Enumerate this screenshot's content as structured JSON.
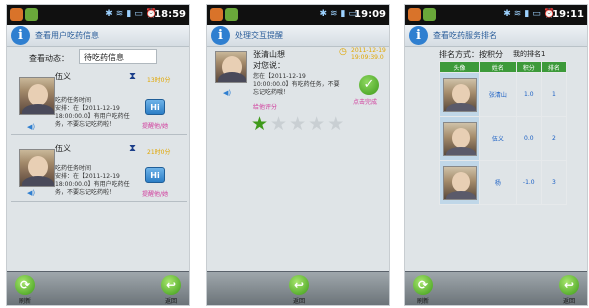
{
  "screens": [
    {
      "time": "18:59",
      "header_title": "查看用户吃药信息",
      "filter_label": "查看动态：",
      "filter_value": "待吃药信息",
      "items": [
        {
          "name": "伍义",
          "remaining": "13时0分",
          "message": "吃药任务时间\n安排：在【2011-12-19\n18:00:00.0】有用户吃药任\n务，不要忘记吃药啦！",
          "hi": "Hi",
          "remind": "提醒他/她"
        },
        {
          "name": "伍义",
          "remaining": "21时0分",
          "message": "吃药任务时间\n安排：在【2011-12-19\n18:00:00.0】有用户吃药任\n务，不要忘记吃药啦！",
          "hi": "Hi",
          "remind": "提醒他/她"
        }
      ],
      "toolbar": {
        "left": "刷新",
        "right": "返回"
      }
    },
    {
      "time": "19:09",
      "header_title": "处理交互提醒",
      "from_name": "张清山想",
      "from_line2": "对您说：",
      "remind_time": "2011-12-19\n19:09:39.0",
      "message": "您在【2011-12-19\n10:00:00.0】有吃药任务，不要\n忘记吃药哦！",
      "done_label": "点击完成",
      "rating_label": "给他评分",
      "rating": 1,
      "rating_max": 5,
      "toolbar": {
        "center": "返回"
      }
    },
    {
      "time": "19:11",
      "header_title": "查看吃药服务排名",
      "sort_label": "排名方式：按积分",
      "my_rank": "我的排名1",
      "columns": [
        "头像",
        "姓名",
        "积分",
        "排名"
      ],
      "rows": [
        {
          "name": "张清山",
          "score": "1.0",
          "rank": "1"
        },
        {
          "name": "伍义",
          "score": "0.0",
          "rank": "2"
        },
        {
          "name": "杨",
          "score": "-1.0",
          "rank": "3"
        }
      ],
      "toolbar": {
        "left": "刷新",
        "right": "返回"
      }
    }
  ],
  "colors": {
    "accent": "#2f7fd0",
    "star_on": "#3f9a1b",
    "remind": "#d13b9c",
    "header_green": "#3d9a3a"
  }
}
